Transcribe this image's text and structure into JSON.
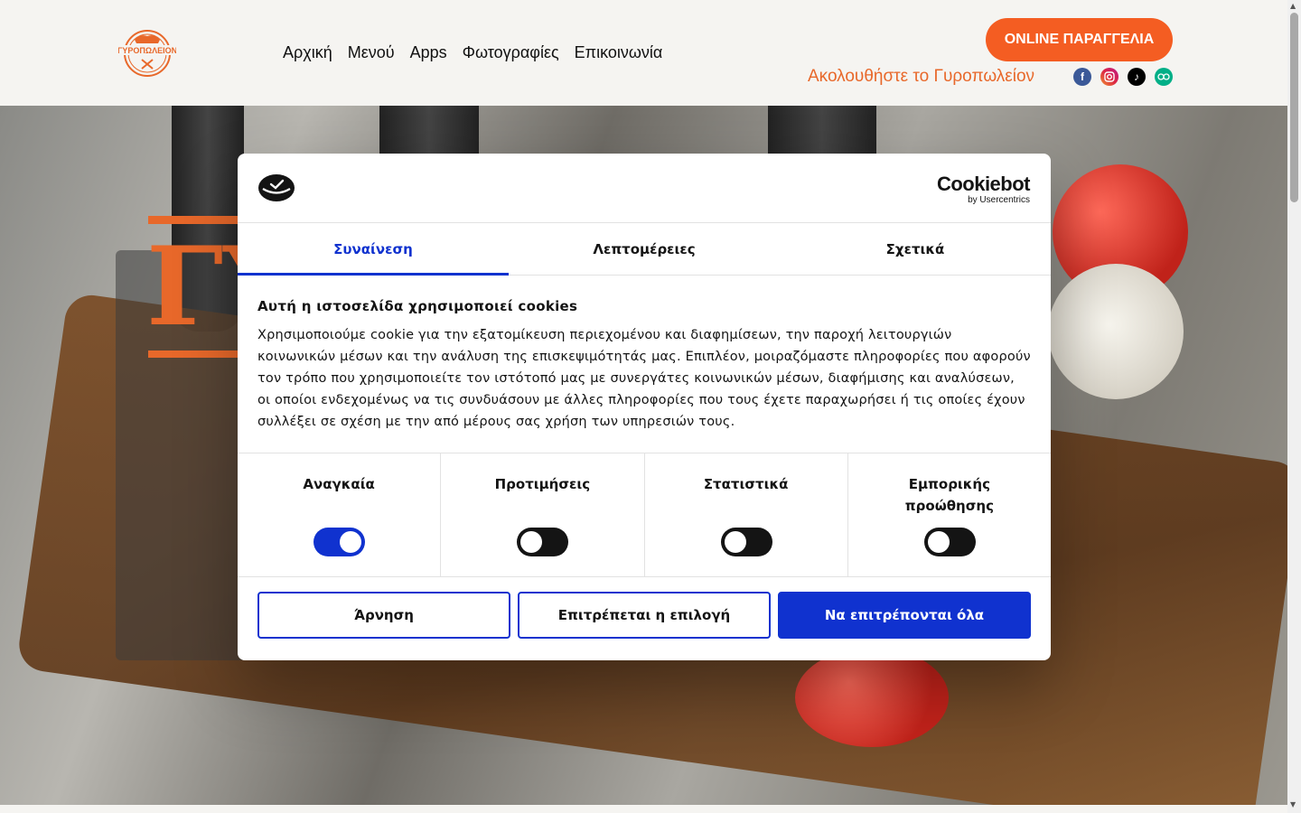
{
  "header": {
    "nav": [
      "Αρχική",
      "Μενού",
      "Apps",
      "Φωτογραφίες",
      "Επικοινωνία"
    ],
    "order_button": "ONLINE ΠΑΡΑΓΓΕΛΙΑ",
    "follow_text": "Ακολουθήστε το Γυροπωλείον",
    "logo_text": "ΓΥΡΟΠΩΛΕΙΟΝ",
    "socials": [
      "facebook-icon",
      "instagram-icon",
      "tiktok-icon",
      "tripadvisor-icon"
    ]
  },
  "hero": {
    "title_fragment": "ΓΥ"
  },
  "cookie_dialog": {
    "brand_name": "Cookiebot",
    "brand_sub": "by Usercentrics",
    "tabs": [
      "Συναίνεση",
      "Λεπτομέρειες",
      "Σχετικά"
    ],
    "active_tab": "Συναίνεση",
    "heading": "Αυτή η ιστοσελίδα χρησιμοποιεί cookies",
    "text": "Χρησιμοποιούμε cookie για την εξατομίκευση περιεχομένου και διαφημίσεων, την παροχή λειτουργιών κοινωνικών μέσων και την ανάλυση της επισκεψιμότητάς μας. Επιπλέον, μοιραζόμαστε πληροφορίες που αφορούν τον τρόπο που χρησιμοποιείτε τον ιστότοπό μας με συνεργάτες κοινωνικών μέσων, διαφήμισης και αναλύσεων, οι οποίοι ενδεχομένως να τις συνδυάσουν με άλλες πληροφορίες που τους έχετε παραχωρήσει ή τις οποίες έχουν συλλέξει σε σχέση με την από μέρους σας χρήση των υπηρεσιών τους.",
    "categories": [
      {
        "label": "Αναγκαία",
        "enabled": true
      },
      {
        "label": "Προτιμήσεις",
        "enabled": false
      },
      {
        "label": "Στατιστικά",
        "enabled": false
      },
      {
        "label": "Εμπορικής προώθησης",
        "enabled": false
      }
    ],
    "buttons": {
      "deny": "Άρνηση",
      "allow_selection": "Επιτρέπεται η επιλογή",
      "allow_all": "Να επιτρέπονται όλα"
    }
  },
  "colors": {
    "brand_orange": "#f45d22",
    "follow_orange": "#e8682a",
    "cookiebot_blue": "#1032cf"
  }
}
